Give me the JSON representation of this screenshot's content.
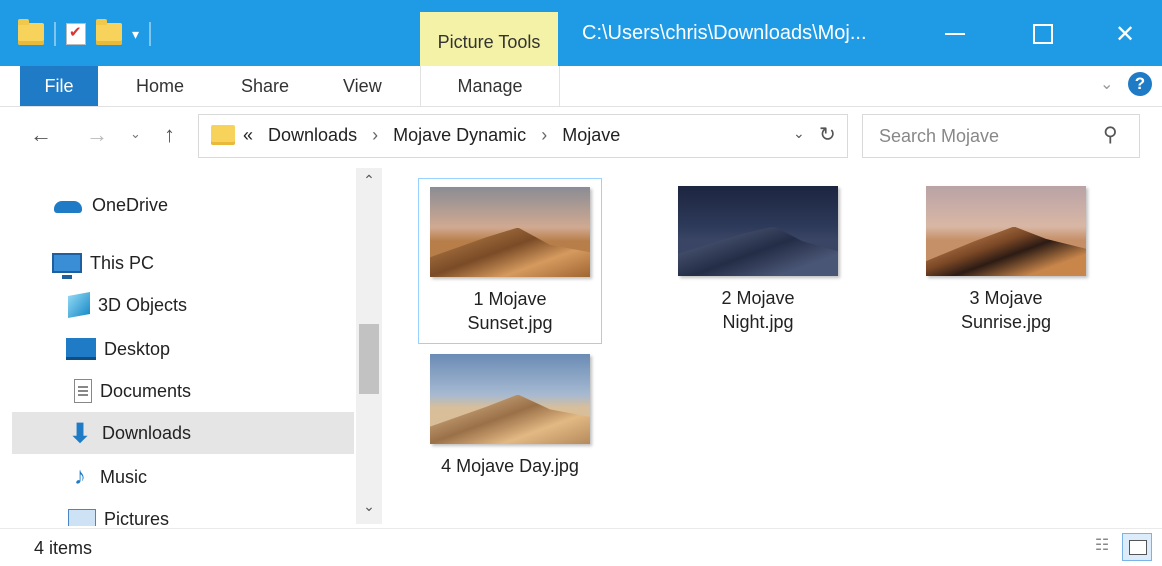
{
  "titlebar": {
    "context_tab": "Picture Tools",
    "path_title": "C:\\Users\\chris\\Downloads\\Moj...",
    "close_glyph": "✕"
  },
  "ribbon": {
    "tabs": [
      "File",
      "Home",
      "Share",
      "View",
      "Manage"
    ],
    "help_glyph": "?"
  },
  "address": {
    "overflow": "«",
    "segments": [
      "Downloads",
      "Mojave Dynamic",
      "Mojave"
    ],
    "separator": "›"
  },
  "search": {
    "placeholder": "Search Mojave"
  },
  "navpane": {
    "items": [
      {
        "label": "OneDrive",
        "icon": "onedrive-icon"
      },
      {
        "label": "This PC",
        "icon": "this-pc-icon"
      },
      {
        "label": "3D Objects",
        "icon": "3d-objects-icon"
      },
      {
        "label": "Desktop",
        "icon": "desktop-icon"
      },
      {
        "label": "Documents",
        "icon": "documents-icon"
      },
      {
        "label": "Downloads",
        "icon": "downloads-icon",
        "selected": true
      },
      {
        "label": "Music",
        "icon": "music-icon"
      },
      {
        "label": "Pictures",
        "icon": "pictures-icon"
      }
    ]
  },
  "files": [
    {
      "name": "1 Mojave\nSunset.jpg",
      "selected": true
    },
    {
      "name": "2 Mojave\nNight.jpg"
    },
    {
      "name": "3 Mojave\nSunrise.jpg"
    },
    {
      "name": "4 Mojave Day.jpg"
    }
  ],
  "status": {
    "count": "4 items"
  },
  "colors": {
    "titlebar": "#1f9be6",
    "file_tab": "#1f7bc6",
    "context_tab": "#f4f2a6",
    "selection_border": "#99d1ff"
  }
}
